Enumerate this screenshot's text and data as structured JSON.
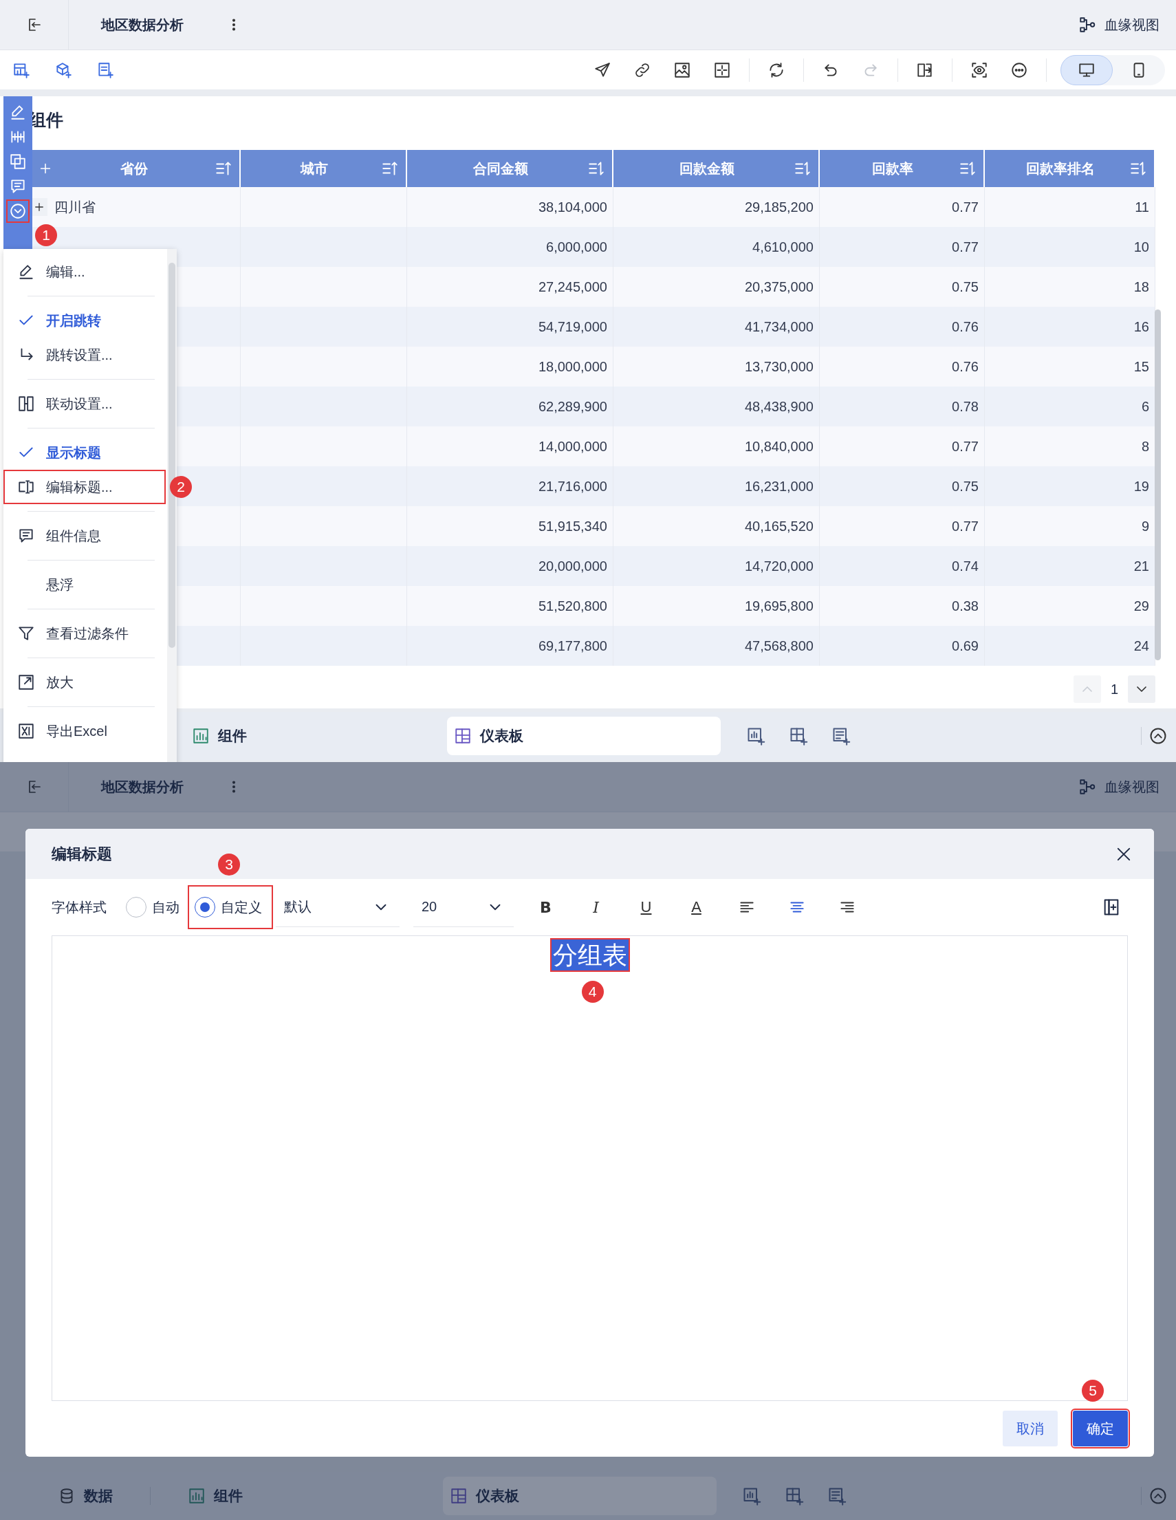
{
  "screen1": {
    "header": {
      "title": "地区数据分析",
      "lineage_label": "血缘视图"
    },
    "toolbar": {
      "actions": [
        {
          "disabled": false
        },
        {
          "disabled": false
        },
        {
          "disabled": false
        },
        {
          "disabled": false
        },
        {
          "disabled": false
        },
        {
          "disabled": false
        },
        {
          "disabled": true
        },
        {
          "disabled": false
        },
        {
          "disabled": false
        },
        {
          "disabled": false
        }
      ],
      "devices": [
        {
          "selected": true
        },
        {
          "selected": false
        }
      ]
    },
    "widget": {
      "title": "组件",
      "side_toolbar": {
        "callout": "1"
      },
      "table": {
        "columns": [
          {
            "label": "省份",
            "sorted": true
          },
          {
            "label": "城市",
            "sorted": true
          },
          {
            "label": "合同金额",
            "sorted": false
          },
          {
            "label": "回款金额",
            "sorted": false
          },
          {
            "label": "回款率",
            "sorted": false
          },
          {
            "label": "回款率排名",
            "sorted": false
          }
        ],
        "rows": [
          {
            "province": "四川省",
            "values": [
              "38,104,000",
              "29,185,200",
              "0.77",
              "11"
            ]
          },
          {
            "values": [
              "6,000,000",
              "4,610,000",
              "0.77",
              "10"
            ]
          },
          {
            "values": [
              "27,245,000",
              "20,375,000",
              "0.75",
              "18"
            ]
          },
          {
            "values": [
              "54,719,000",
              "41,734,000",
              "0.76",
              "16"
            ]
          },
          {
            "values": [
              "18,000,000",
              "13,730,000",
              "0.76",
              "15"
            ]
          },
          {
            "values": [
              "62,289,900",
              "48,438,900",
              "0.78",
              "6"
            ]
          },
          {
            "values": [
              "14,000,000",
              "10,840,000",
              "0.77",
              "8"
            ]
          },
          {
            "values": [
              "21,716,000",
              "16,231,000",
              "0.75",
              "19"
            ]
          },
          {
            "values": [
              "51,915,340",
              "40,165,520",
              "0.77",
              "9"
            ]
          },
          {
            "values": [
              "20,000,000",
              "14,720,000",
              "0.74",
              "21"
            ]
          },
          {
            "values": [
              "51,520,800",
              "19,695,800",
              "0.38",
              "29"
            ]
          },
          {
            "values": [
              "69,177,800",
              "47,568,800",
              "0.69",
              "24"
            ]
          }
        ]
      },
      "pagination": {
        "page": "1",
        "prev_disabled": true
      }
    },
    "menu": {
      "groups": [
        [
          {
            "kind": "action",
            "label": "编辑..."
          }
        ],
        [
          {
            "kind": "toggle",
            "label": "开启跳转",
            "checked": true
          },
          {
            "kind": "action",
            "label": "跳转设置..."
          }
        ],
        [
          {
            "kind": "action",
            "label": "联动设置..."
          }
        ],
        [
          {
            "kind": "toggle",
            "label": "显示标题",
            "checked": true
          },
          {
            "kind": "action",
            "label": "编辑标题...",
            "callout": "2"
          }
        ],
        [
          {
            "kind": "action",
            "label": "组件信息"
          }
        ],
        [
          {
            "kind": "toggle",
            "label": "悬浮",
            "checked": false
          }
        ],
        [
          {
            "kind": "action",
            "label": "查看过滤条件"
          }
        ],
        [
          {
            "kind": "action",
            "label": "放大"
          }
        ],
        [
          {
            "kind": "action",
            "label": "导出Excel"
          }
        ]
      ]
    },
    "tabbar": {
      "tabs": [
        {
          "label": "组件",
          "kind": "widget",
          "selected": false
        },
        {
          "label": "仪表板",
          "kind": "dashboard",
          "selected": true
        }
      ]
    }
  },
  "screen2": {
    "header": {
      "title": "地区数据分析",
      "lineage_label": "血缘视图"
    },
    "tabbar": {
      "tabs": [
        {
          "label": "数据",
          "kind": "data",
          "selected": false
        },
        {
          "label": "组件",
          "kind": "widget",
          "selected": false
        },
        {
          "label": "仪表板",
          "kind": "dashboard",
          "selected": true
        }
      ]
    },
    "dialog": {
      "title": "编辑标题",
      "font_style_label": "字体样式",
      "options": [
        {
          "label": "自动",
          "selected": false
        },
        {
          "label": "自定义",
          "selected": true,
          "callout": "3"
        }
      ],
      "font": "默认",
      "size": "20",
      "format": [
        {
          "kind": "bold",
          "label": "B",
          "on": false
        },
        {
          "kind": "italic",
          "label": "I",
          "on": false
        },
        {
          "kind": "underline",
          "label": "U",
          "on": false
        },
        {
          "kind": "color",
          "label": "A",
          "on": false
        }
      ],
      "align": [
        {
          "kind": "left",
          "selected": false
        },
        {
          "kind": "center",
          "selected": true
        },
        {
          "kind": "right",
          "selected": false
        }
      ],
      "content": {
        "text": "分组表",
        "highlighted": true,
        "callout": "4"
      },
      "cancel": "取消",
      "confirm": {
        "label": "确定",
        "callout": "5"
      }
    }
  }
}
